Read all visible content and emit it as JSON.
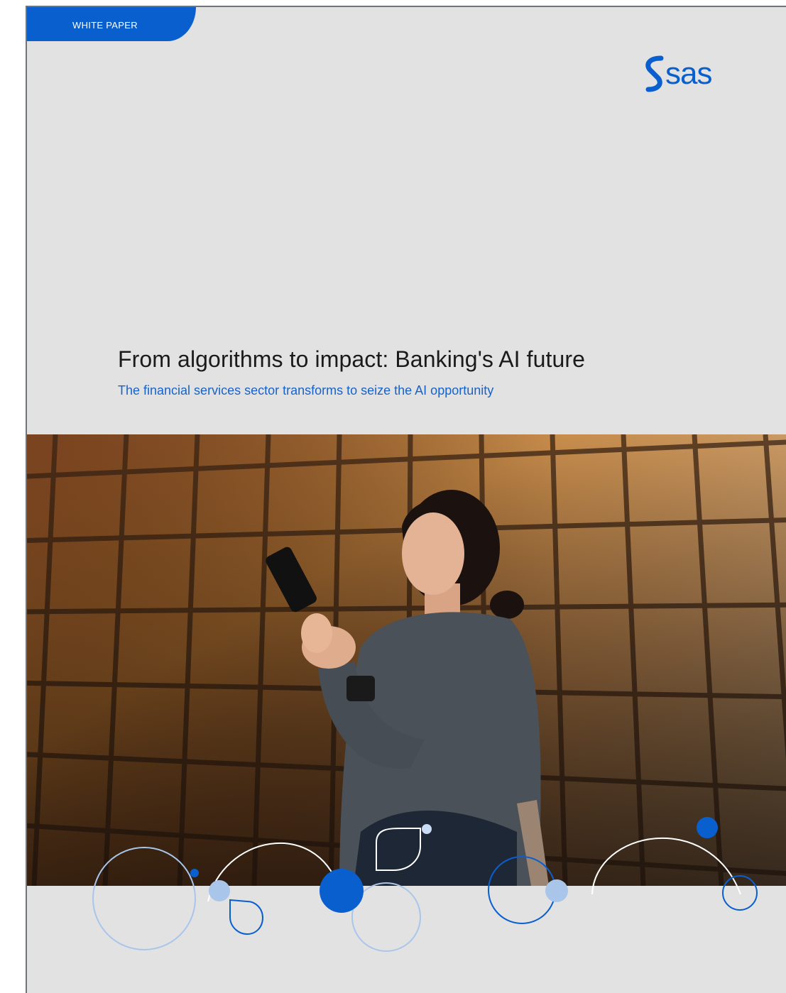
{
  "header": {
    "label": "WHITE PAPER",
    "logo": {
      "name": "sas-logo",
      "text": "sas",
      "color": "#0a5fce"
    }
  },
  "cover": {
    "title": "From algorithms to impact: Banking's AI future",
    "subtitle": "The financial services sector transforms to seize the AI opportunity"
  },
  "photo": {
    "subject": "woman-with-smartphone-photo",
    "palette": {
      "building": "#9a5a26",
      "shadow": "#2a1a12",
      "sweater": "#4b5158",
      "skin": "#e4b395",
      "hair": "#1b1210"
    }
  },
  "colors": {
    "accent": "#0a5fce",
    "accent_light": "#a9c6ea",
    "background": "#e2e2e2",
    "title_text": "#1b1b1b",
    "subtitle_text": "#1763c9"
  }
}
